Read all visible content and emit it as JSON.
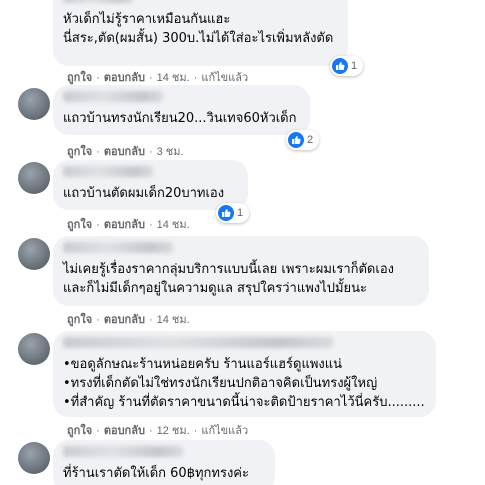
{
  "comments": [
    {
      "lines": [
        "หัวเด็กไม่รู้ราคาเหมือนกันแฮะ",
        "นี่สระ,ตัด(ผมสั้น) 300บ.ไม่ได้ใส่อะไรเพิ่มหลังตัด"
      ],
      "reactions": "1",
      "like": "ถูกใจ",
      "reply": "ตอบกลับ",
      "time": "14 ชม.",
      "edited": "แก้ไขแล้ว"
    },
    {
      "lines": [
        "แถวบ้านทรงนักเรียน20...วินเทจ60หัวเด็ก"
      ],
      "reactions": "2",
      "like": "ถูกใจ",
      "reply": "ตอบกลับ",
      "time": "3 ชม."
    },
    {
      "lines": [
        "แถวบ้านตัดผมเด็ก20บาทเอง"
      ],
      "reactions": "1",
      "like": "ถูกใจ",
      "reply": "ตอบกลับ",
      "time": "14 ชม."
    },
    {
      "lines": [
        "ไม่เคยรู้เรื่องราคากลุ่มบริการแบบนี้เลย เพราะผมเราก็ตัดเอง",
        "และก็ไม่มีเด็กๆอยู่ในความดูแล สรุปใครว่าแพงไปมั้ยนะ"
      ],
      "like": "ถูกใจ",
      "reply": "ตอบกลับ",
      "time": "14 ชม."
    },
    {
      "lines": [
        "•ขอดูลักษณะร้านหน่อยครับ ร้านแอร์แฮร์ดูแพงแน่",
        "•ทรงที่เด็กตัดไม่ใช่ทรงนักเรียนปกติอาจคิดเป็นทรงผู้ใหญ่",
        "•ที่สำคัญ ร้านที่ตัดราคาขนาดนี้น่าจะติดป้ายราคาไว้นี่ครับ........."
      ],
      "like": "ถูกใจ",
      "reply": "ตอบกลับ",
      "time": "12 ชม.",
      "edited": "แก้ไขแล้ว"
    },
    {
      "lines": [
        "ที่ร้านเราตัดให้เด็ก 60฿ทุกทรงค่ะ"
      ]
    }
  ],
  "colors": {
    "bubble": "#f0f2f5",
    "meta": "#65676b",
    "like_blue": "#1877f2"
  }
}
